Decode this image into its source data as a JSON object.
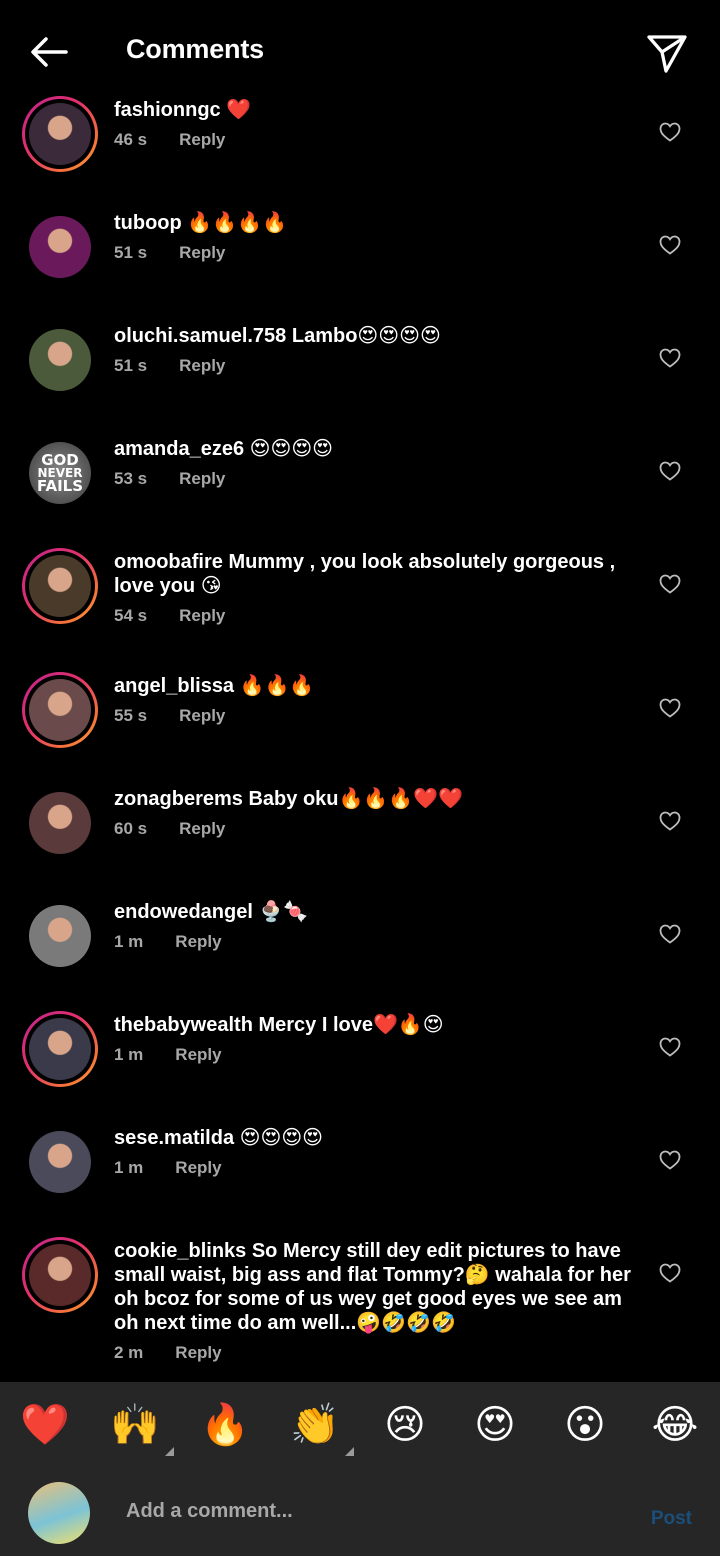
{
  "header": {
    "title": "Comments"
  },
  "comments": [
    {
      "user": "fashionngc",
      "text": "fashionngc ❤️",
      "time": "46 s",
      "reply": "Reply",
      "ring": true
    },
    {
      "user": "tuboop",
      "text": "tuboop 🔥🔥🔥🔥",
      "time": "51 s",
      "reply": "Reply",
      "ring": false
    },
    {
      "user": "oluchi.samuel.758",
      "text": "oluchi.samuel.758 Lambo😍😍😍😍",
      "time": "51 s",
      "reply": "Reply",
      "ring": false
    },
    {
      "user": "amanda_eze6",
      "text": "amanda_eze6 😍😍😍😍",
      "time": "53 s",
      "reply": "Reply",
      "ring": false,
      "avatar_text": [
        "GOD",
        "NEVER",
        "FAILS"
      ]
    },
    {
      "user": "omoobafire",
      "text": "omoobafire Mummy , you look absolutely gorgeous , love you 😘",
      "time": "54 s",
      "reply": "Reply",
      "ring": true
    },
    {
      "user": "angel_blissa",
      "text": "angel_blissa 🔥🔥🔥",
      "time": "55 s",
      "reply": "Reply",
      "ring": true
    },
    {
      "user": "zonagberems",
      "text": "zonagberems Baby oku🔥🔥🔥❤️❤️",
      "time": "60 s",
      "reply": "Reply",
      "ring": false
    },
    {
      "user": "endowedangel",
      "text": "endowedangel 🍨🍬",
      "time": "1 m",
      "reply": "Reply",
      "ring": false
    },
    {
      "user": "thebabywealth",
      "text": "thebabywealth Mercy I love❤️🔥😍",
      "time": "1 m",
      "reply": "Reply",
      "ring": true
    },
    {
      "user": "sese.matilda",
      "text": "sese.matilda 😍😍😍😍",
      "time": "1 m",
      "reply": "Reply",
      "ring": false
    },
    {
      "user": "cookie_blinks",
      "text": "cookie_blinks So Mercy still dey edit pictures to have small waist, big ass and flat Tommy?🤔 wahala for her oh bcoz for some of us wey get good eyes we see am oh next time do am well...🤪🤣🤣🤣",
      "time": "2 m",
      "reply": "Reply",
      "ring": true
    }
  ],
  "emoji_bar": [
    "❤️",
    "🙌",
    "🔥",
    "👏",
    "😢",
    "😍",
    "😮",
    "😂"
  ],
  "composer": {
    "placeholder": "Add a comment...",
    "post_label": "Post"
  },
  "colors": {
    "background": "#000000",
    "panel": "#262626",
    "secondary_text": "#a8a8a8",
    "post_disabled": "#1b4f7a"
  }
}
